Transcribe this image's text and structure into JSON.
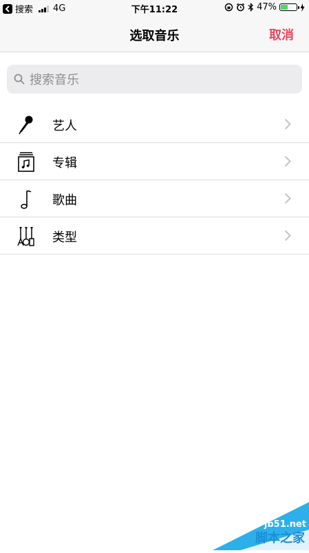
{
  "status_bar": {
    "back_app": "搜索",
    "network": "4G",
    "time": "下午11:22",
    "battery": "47%",
    "battery_level": 0.47
  },
  "nav": {
    "title": "选取音乐",
    "cancel": "取消"
  },
  "search": {
    "placeholder": "搜索音乐",
    "icon": "search-icon"
  },
  "list": [
    {
      "label": "艺人",
      "icon": "microphone-icon"
    },
    {
      "label": "专辑",
      "icon": "album-icon"
    },
    {
      "label": "歌曲",
      "icon": "music-note-icon"
    },
    {
      "label": "类型",
      "icon": "genre-icon"
    }
  ],
  "watermark": {
    "site": "jb51.net",
    "name": "脚本之家"
  },
  "colors": {
    "accent": "#f0435d",
    "battery": "#4cd964",
    "placeholder": "#8e8e93"
  }
}
